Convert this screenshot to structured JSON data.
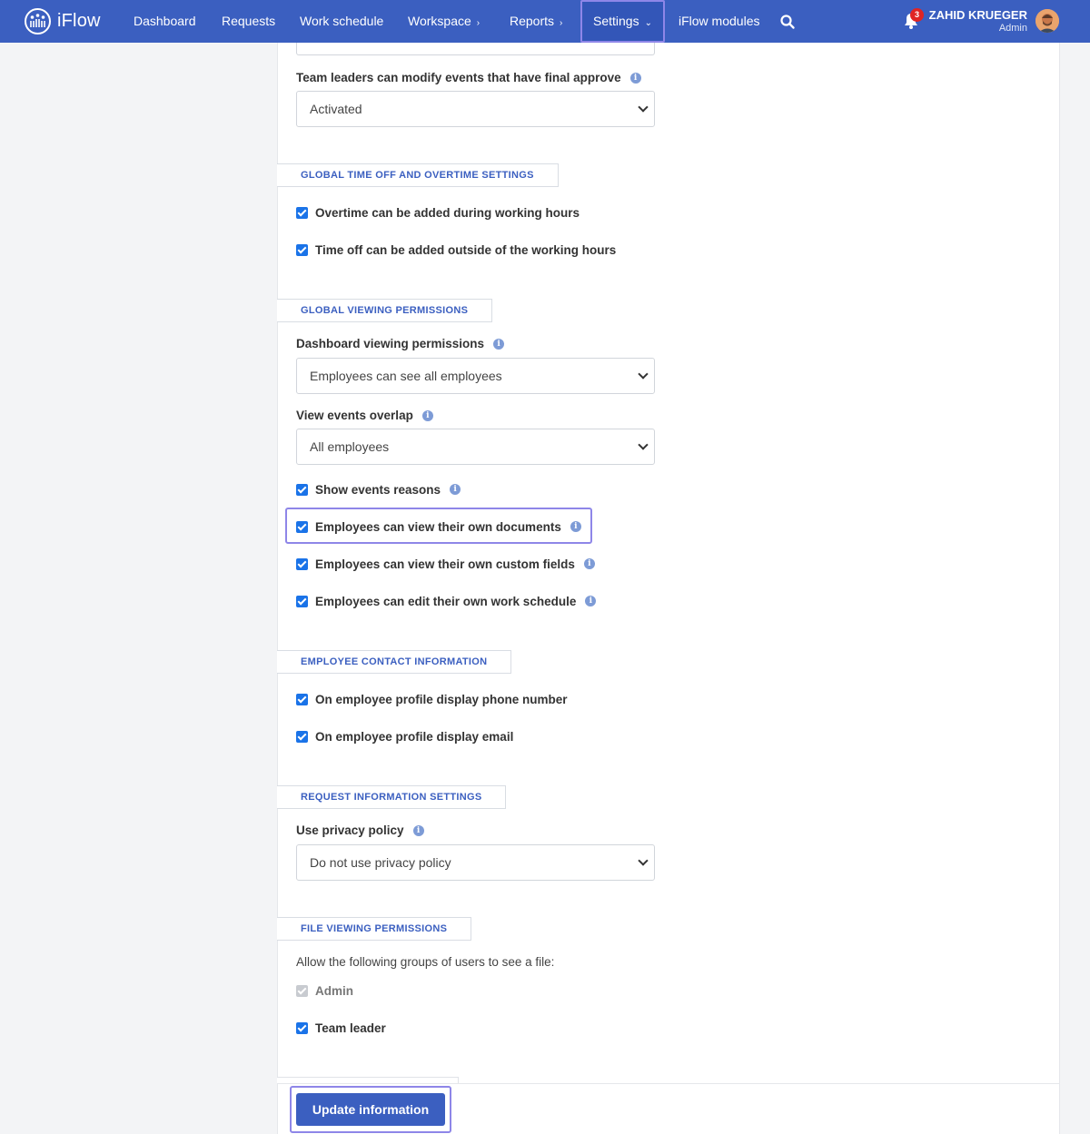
{
  "app": {
    "name": "iFlow"
  },
  "nav": {
    "dashboard": "Dashboard",
    "requests": "Requests",
    "work_schedule": "Work schedule",
    "workspace": "Workspace",
    "reports": "Reports",
    "settings": "Settings",
    "modules": "iFlow modules",
    "search_icon": "search-icon",
    "notifications_count": "3"
  },
  "user": {
    "name": "ZAHID KRUEGER",
    "role": "Admin"
  },
  "colors": {
    "brand": "#3b5fc0",
    "checkbox": "#1a73e8",
    "highlight": "#8e86e8",
    "badge": "#e02424"
  },
  "settings": {
    "team_leaders_modify": {
      "label": "Team leaders can modify events that have final approve",
      "value": "Activated"
    },
    "time_off_section": {
      "title": "GLOBAL TIME OFF AND OVERTIME SETTINGS",
      "overtime": "Overtime can be added during working hours",
      "time_off_outside": "Time off can be added outside of the working hours"
    },
    "viewing_section": {
      "title": "GLOBAL VIEWING PERMISSIONS",
      "dashboard_perm": {
        "label": "Dashboard viewing permissions",
        "value": "Employees can see all employees"
      },
      "events_overlap": {
        "label": "View events overlap",
        "value": "All employees"
      },
      "show_reasons": "Show events reasons",
      "own_documents": "Employees can view their own documents",
      "own_custom_fields": "Employees can view their own custom fields",
      "edit_schedule": "Employees can edit their own work schedule"
    },
    "contact_section": {
      "title": "EMPLOYEE CONTACT INFORMATION",
      "phone": "On employee profile display phone number",
      "email": "On employee profile display email"
    },
    "request_section": {
      "title": "REQUEST INFORMATION SETTINGS",
      "privacy": {
        "label": "Use privacy policy",
        "value": "Do not use privacy policy"
      }
    },
    "file_section": {
      "title": "FILE VIEWING PERMISSIONS",
      "intro": "Allow the following groups of users to see a file:",
      "admin": "Admin",
      "team_leader": "Team leader"
    }
  },
  "actions": {
    "update": "Update information"
  }
}
